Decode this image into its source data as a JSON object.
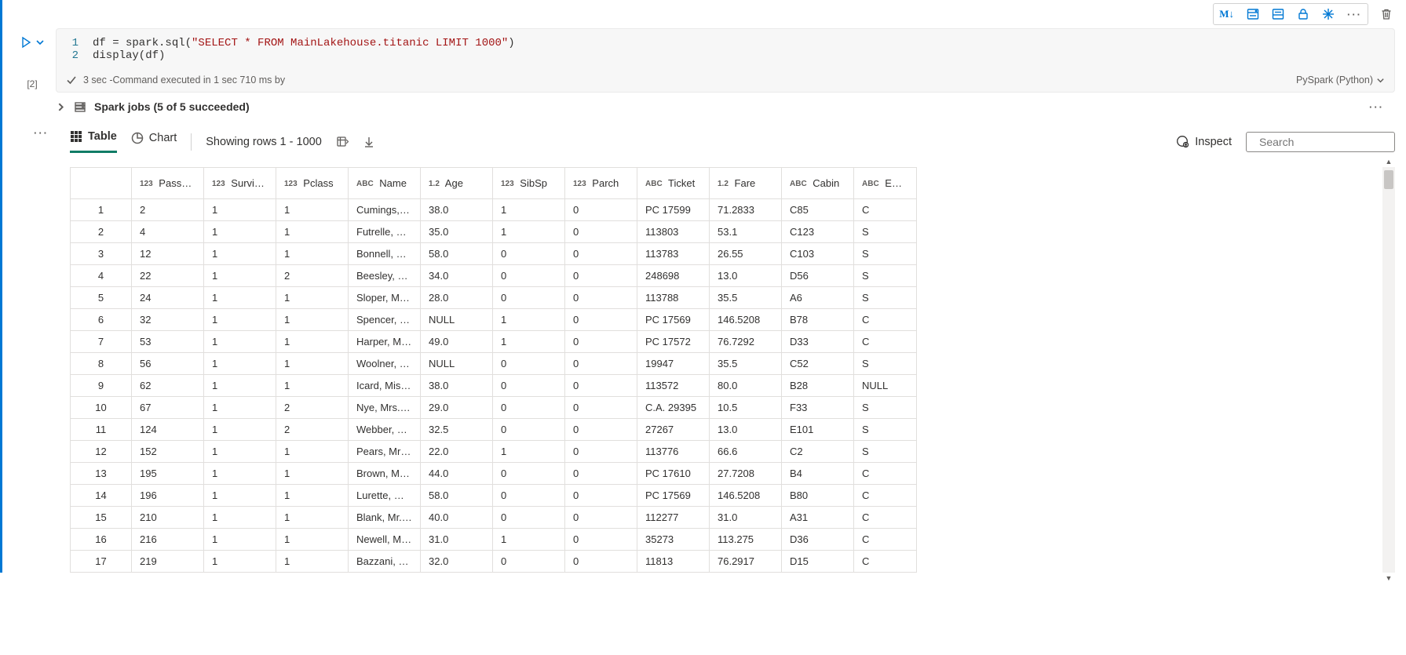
{
  "toolbar": {
    "markdown": "M↓"
  },
  "cell": {
    "exec_count": "[2]",
    "code_lines": [
      {
        "n": "1",
        "parts": [
          {
            "t": "df = spark.sql(",
            "c": "tok-kw1"
          },
          {
            "t": "\"SELECT * FROM MainLakehouse.titanic LIMIT 1000\"",
            "c": "tok-str"
          },
          {
            "t": ")",
            "c": "tok-kw1"
          }
        ]
      },
      {
        "n": "2",
        "parts": [
          {
            "t": "display(df)",
            "c": "tok-kw1"
          }
        ]
      }
    ],
    "status_prefix": "3 sec",
    "status_text": " -Command executed in 1 sec 710 ms by",
    "language": "PySpark (Python)"
  },
  "spark_jobs": {
    "label": "Spark jobs (5 of 5 succeeded)"
  },
  "view": {
    "table": "Table",
    "chart": "Chart",
    "rows": "Showing rows 1 - 1000",
    "inspect": "Inspect",
    "search_placeholder": "Search"
  },
  "columns": [
    {
      "dtype": "123",
      "name": "Passenger...",
      "cls": "col-w-pass"
    },
    {
      "dtype": "123",
      "name": "Survived",
      "cls": "col-w-surv"
    },
    {
      "dtype": "123",
      "name": "Pclass",
      "cls": "col-w-pcl"
    },
    {
      "dtype": "ABC",
      "name": "Name",
      "cls": "col-w-name"
    },
    {
      "dtype": "1.2",
      "name": "Age",
      "cls": "col-w-age"
    },
    {
      "dtype": "123",
      "name": "SibSp",
      "cls": "col-w-sib"
    },
    {
      "dtype": "123",
      "name": "Parch",
      "cls": "col-w-par"
    },
    {
      "dtype": "ABC",
      "name": "Ticket",
      "cls": "col-w-tic"
    },
    {
      "dtype": "1.2",
      "name": "Fare",
      "cls": "col-w-far"
    },
    {
      "dtype": "ABC",
      "name": "Cabin",
      "cls": "col-w-cab"
    },
    {
      "dtype": "ABC",
      "name": "Embarked",
      "cls": "col-w-emb"
    }
  ],
  "rows": [
    {
      "n": "1",
      "v": [
        "2",
        "1",
        "1",
        "Cumings, M...",
        "38.0",
        "1",
        "0",
        "PC 17599",
        "71.2833",
        "C85",
        "C"
      ]
    },
    {
      "n": "2",
      "v": [
        "4",
        "1",
        "1",
        "Futrelle, Mrs...",
        "35.0",
        "1",
        "0",
        "113803",
        "53.1",
        "C123",
        "S"
      ]
    },
    {
      "n": "3",
      "v": [
        "12",
        "1",
        "1",
        "Bonnell, Mis...",
        "58.0",
        "0",
        "0",
        "113783",
        "26.55",
        "C103",
        "S"
      ]
    },
    {
      "n": "4",
      "v": [
        "22",
        "1",
        "2",
        "Beesley, Mr....",
        "34.0",
        "0",
        "0",
        "248698",
        "13.0",
        "D56",
        "S"
      ]
    },
    {
      "n": "5",
      "v": [
        "24",
        "1",
        "1",
        "Sloper, Mr. ...",
        "28.0",
        "0",
        "0",
        "113788",
        "35.5",
        "A6",
        "S"
      ]
    },
    {
      "n": "6",
      "v": [
        "32",
        "1",
        "1",
        "Spencer, Mr...",
        "NULL",
        "1",
        "0",
        "PC 17569",
        "146.5208",
        "B78",
        "C"
      ]
    },
    {
      "n": "7",
      "v": [
        "53",
        "1",
        "1",
        "Harper, Mrs....",
        "49.0",
        "1",
        "0",
        "PC 17572",
        "76.7292",
        "D33",
        "C"
      ]
    },
    {
      "n": "8",
      "v": [
        "56",
        "1",
        "1",
        "Woolner, M...",
        "NULL",
        "0",
        "0",
        "19947",
        "35.5",
        "C52",
        "S"
      ]
    },
    {
      "n": "9",
      "v": [
        "62",
        "1",
        "1",
        "Icard, Miss. ...",
        "38.0",
        "0",
        "0",
        "113572",
        "80.0",
        "B28",
        "NULL"
      ]
    },
    {
      "n": "10",
      "v": [
        "67",
        "1",
        "2",
        "Nye, Mrs. (E...",
        "29.0",
        "0",
        "0",
        "C.A. 29395",
        "10.5",
        "F33",
        "S"
      ]
    },
    {
      "n": "11",
      "v": [
        "124",
        "1",
        "2",
        "Webber, Mi...",
        "32.5",
        "0",
        "0",
        "27267",
        "13.0",
        "E101",
        "S"
      ]
    },
    {
      "n": "12",
      "v": [
        "152",
        "1",
        "1",
        "Pears, Mrs. ...",
        "22.0",
        "1",
        "0",
        "113776",
        "66.6",
        "C2",
        "S"
      ]
    },
    {
      "n": "13",
      "v": [
        "195",
        "1",
        "1",
        "Brown, Mrs. ...",
        "44.0",
        "0",
        "0",
        "PC 17610",
        "27.7208",
        "B4",
        "C"
      ]
    },
    {
      "n": "14",
      "v": [
        "196",
        "1",
        "1",
        "Lurette, Mis...",
        "58.0",
        "0",
        "0",
        "PC 17569",
        "146.5208",
        "B80",
        "C"
      ]
    },
    {
      "n": "15",
      "v": [
        "210",
        "1",
        "1",
        "Blank, Mr. H...",
        "40.0",
        "0",
        "0",
        "112277",
        "31.0",
        "A31",
        "C"
      ]
    },
    {
      "n": "16",
      "v": [
        "216",
        "1",
        "1",
        "Newell, Mis...",
        "31.0",
        "1",
        "0",
        "35273",
        "113.275",
        "D36",
        "C"
      ]
    },
    {
      "n": "17",
      "v": [
        "219",
        "1",
        "1",
        "Bazzani, Mis...",
        "32.0",
        "0",
        "0",
        "11813",
        "76.2917",
        "D15",
        "C"
      ]
    }
  ]
}
